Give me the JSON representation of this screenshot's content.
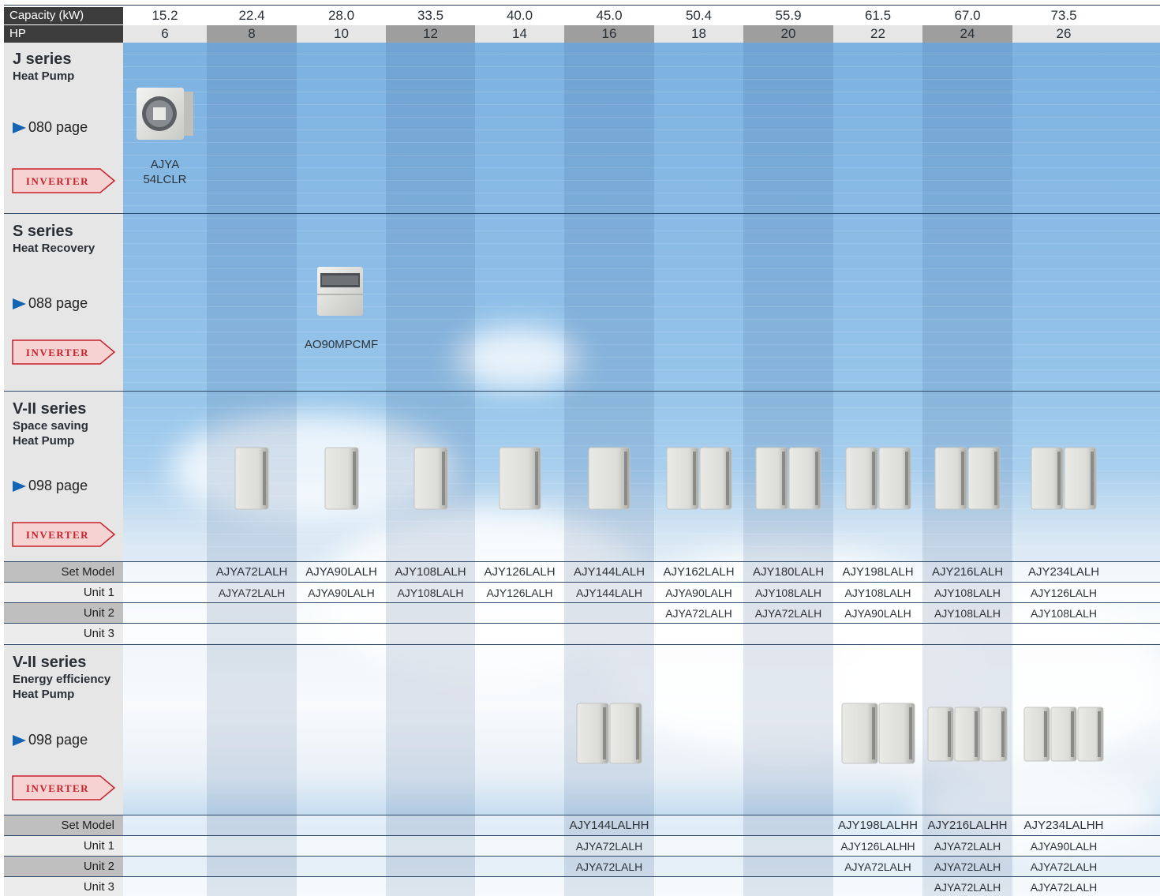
{
  "header": {
    "capacity_label": "Capacity (kW)",
    "hp_label": "HP",
    "capacities": [
      "15.2",
      "22.4",
      "28.0",
      "33.5",
      "40.0",
      "45.0",
      "50.4",
      "55.9",
      "61.5",
      "67.0",
      "73.5"
    ],
    "hp": [
      "6",
      "8",
      "10",
      "12",
      "14",
      "16",
      "18",
      "20",
      "22",
      "24",
      "26"
    ]
  },
  "sections": [
    {
      "title": "J series",
      "subtitle": [
        "Heat Pump"
      ],
      "page": "080 page",
      "badge": "INVERTER"
    },
    {
      "title": "S series",
      "subtitle": [
        "Heat Recovery"
      ],
      "page": "088 page",
      "badge": "INVERTER"
    },
    {
      "title": "V-II series",
      "subtitle": [
        "Space saving",
        "Heat Pump"
      ],
      "page": "098 page",
      "badge": "INVERTER"
    },
    {
      "title": "V-II series",
      "subtitle": [
        "Energy efficiency",
        "Heat Pump"
      ],
      "page": "098 page",
      "badge": "INVERTER"
    }
  ],
  "products": {
    "j_model_line1": "AJYA",
    "j_model_line2": "54LCLR",
    "s_model": "AO90MPCMF"
  },
  "table_space_saving": {
    "labels": [
      "Set Model",
      "Unit 1",
      "Unit 2",
      "Unit 3"
    ],
    "set_model": [
      "",
      "AJYA72LALH",
      "AJYA90LALH",
      "AJY108LALH",
      "AJY126LALH",
      "AJY144LALH",
      "AJY162LALH",
      "AJY180LALH",
      "AJY198LALH",
      "AJY216LALH",
      "AJY234LALH"
    ],
    "unit1": [
      "",
      "AJYA72LALH",
      "AJYA90LALH",
      "AJY108LALH",
      "AJY126LALH",
      "AJY144LALH",
      "AJYA90LALH",
      "AJY108LALH",
      "AJY108LALH",
      "AJY108LALH",
      "AJY126LALH"
    ],
    "unit2": [
      "",
      "",
      "",
      "",
      "",
      "",
      "AJYA72LALH",
      "AJYA72LALH",
      "AJYA90LALH",
      "AJY108LALH",
      "AJY108LALH"
    ],
    "unit3": [
      "",
      "",
      "",
      "",
      "",
      "",
      "",
      "",
      "",
      "",
      ""
    ]
  },
  "table_energy_efficiency": {
    "labels": [
      "Set Model",
      "Unit 1",
      "Unit 2",
      "Unit 3"
    ],
    "set_model": [
      "",
      "",
      "",
      "",
      "",
      "AJY144LALHH",
      "",
      "",
      "AJY198LALHH",
      "AJY216LALHH",
      "AJY234LALHH"
    ],
    "unit1": [
      "",
      "",
      "",
      "",
      "",
      "AJYA72LALH",
      "",
      "",
      "AJY126LALHH",
      "AJYA72LALH",
      "AJYA90LALH"
    ],
    "unit2": [
      "",
      "",
      "",
      "",
      "",
      "AJYA72LALH",
      "",
      "",
      "AJYA72LALH",
      "AJYA72LALH",
      "AJYA72LALH"
    ],
    "unit3": [
      "",
      "",
      "",
      "",
      "",
      "",
      "",
      "",
      "",
      "AJYA72LALH",
      "AJYA72LALH"
    ]
  },
  "colors": {
    "header_label_bg": "#3c3c3c",
    "arrow": "#1464b4",
    "badge": "#c8202a"
  }
}
